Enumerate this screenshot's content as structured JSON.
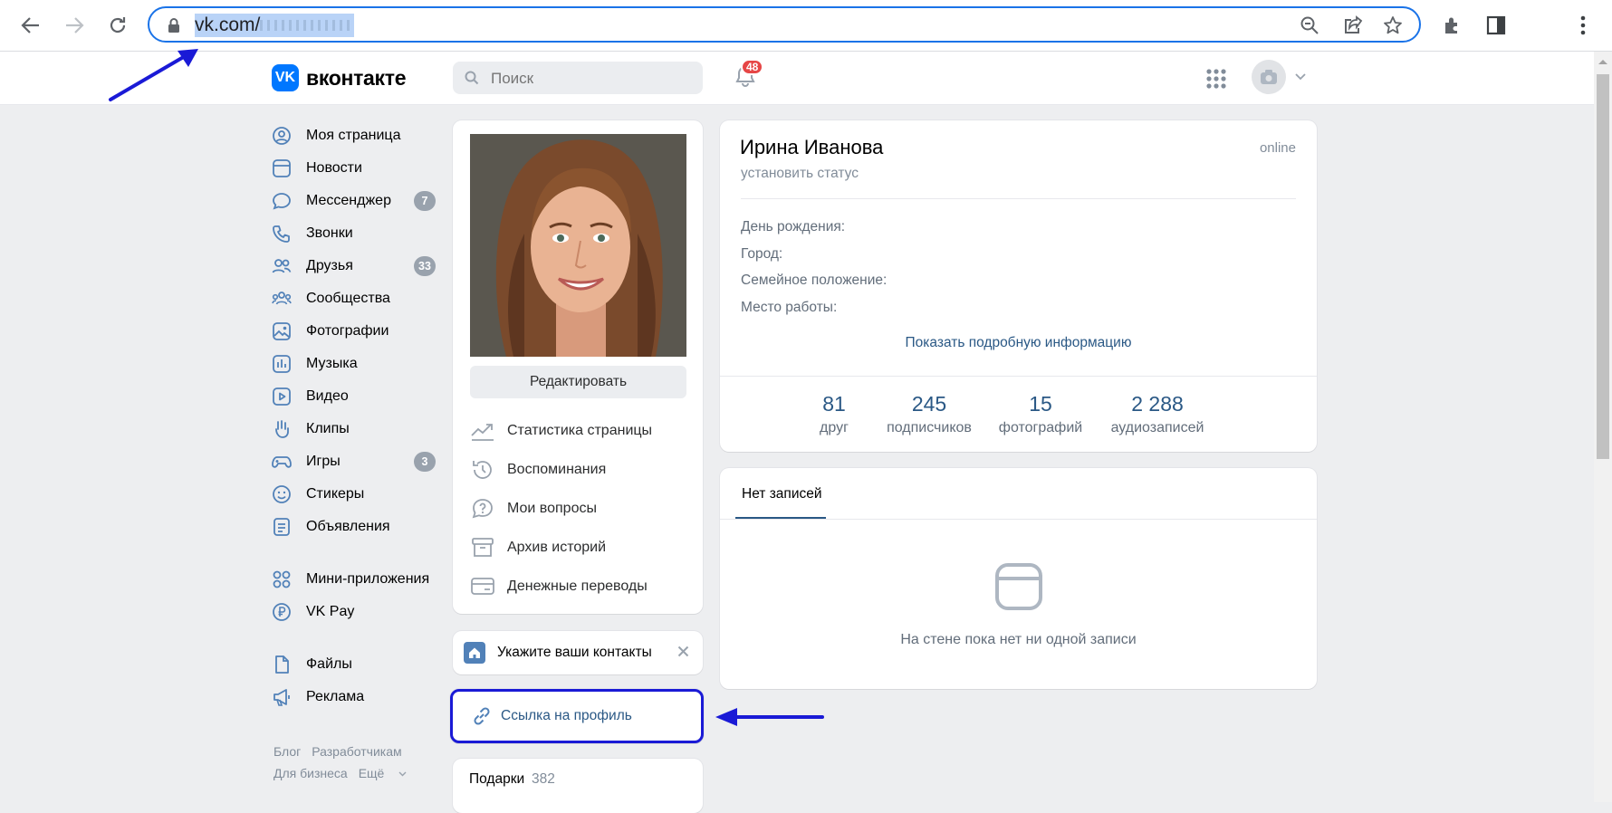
{
  "browser": {
    "url_visible": "vk.com/",
    "icons": [
      "back-icon",
      "forward-icon",
      "reload-icon",
      "lock-icon",
      "zoom-out-icon",
      "share-icon",
      "star-icon",
      "extensions-icon",
      "side-panel-icon",
      "menu-icon"
    ]
  },
  "header": {
    "logo_text": "вконтакте",
    "search_placeholder": "Поиск",
    "notifications_badge": "48"
  },
  "left_menu": {
    "items": [
      {
        "label": "Моя страница",
        "icon": "user-icon"
      },
      {
        "label": "Новости",
        "icon": "news-icon"
      },
      {
        "label": "Мессенджер",
        "icon": "message-icon",
        "badge": "7"
      },
      {
        "label": "Звонки",
        "icon": "phone-icon"
      },
      {
        "label": "Друзья",
        "icon": "friends-icon",
        "badge": "33"
      },
      {
        "label": "Сообщества",
        "icon": "communities-icon"
      },
      {
        "label": "Фотографии",
        "icon": "photo-icon"
      },
      {
        "label": "Музыка",
        "icon": "music-icon"
      },
      {
        "label": "Видео",
        "icon": "video-icon"
      },
      {
        "label": "Клипы",
        "icon": "clips-icon"
      },
      {
        "label": "Игры",
        "icon": "games-icon",
        "badge": "3"
      },
      {
        "label": "Стикеры",
        "icon": "smile-icon"
      },
      {
        "label": "Объявления",
        "icon": "ads-icon"
      },
      {
        "label": "Мини-приложения",
        "icon": "apps-icon"
      },
      {
        "label": "VK Pay",
        "icon": "vkpay-icon"
      },
      {
        "label": "Файлы",
        "icon": "file-icon"
      },
      {
        "label": "Реклама",
        "icon": "megaphone-icon"
      }
    ],
    "footer": {
      "blog": "Блог",
      "developers": "Разработчикам",
      "business": "Для бизнеса",
      "more": "Ещё"
    }
  },
  "photo_card": {
    "edit_label": "Редактировать",
    "items": [
      {
        "label": "Статистика страницы",
        "icon": "stats-icon"
      },
      {
        "label": "Воспоминания",
        "icon": "history-icon"
      },
      {
        "label": "Мои вопросы",
        "icon": "question-icon"
      },
      {
        "label": "Архив историй",
        "icon": "archive-icon"
      },
      {
        "label": "Денежные переводы",
        "icon": "money-transfer-icon"
      }
    ]
  },
  "contacts_card": {
    "label": "Укажите ваши контакты"
  },
  "link_card": {
    "label": "Ссылка на профиль"
  },
  "gifts_card": {
    "label": "Подарки",
    "count": "382"
  },
  "profile": {
    "name": "Ирина Иванова",
    "online": "online",
    "status_placeholder": "установить статус",
    "fields": [
      "День рождения:",
      "Город:",
      "Семейное положение:",
      "Место работы:"
    ],
    "more_info": "Показать подробную информацию",
    "stats": [
      {
        "num": "81",
        "label": "друг"
      },
      {
        "num": "245",
        "label": "подписчиков"
      },
      {
        "num": "15",
        "label": "фотографий"
      },
      {
        "num": "2 288",
        "label": "аудиозаписей"
      }
    ]
  },
  "wall": {
    "tab": "Нет записей",
    "empty_text": "На стене пока нет ни одной записи"
  },
  "colors": {
    "accent": "#2a5885",
    "vk_blue": "#0077ff",
    "annotation": "#1a1ad6",
    "badge_red": "#e64646"
  }
}
